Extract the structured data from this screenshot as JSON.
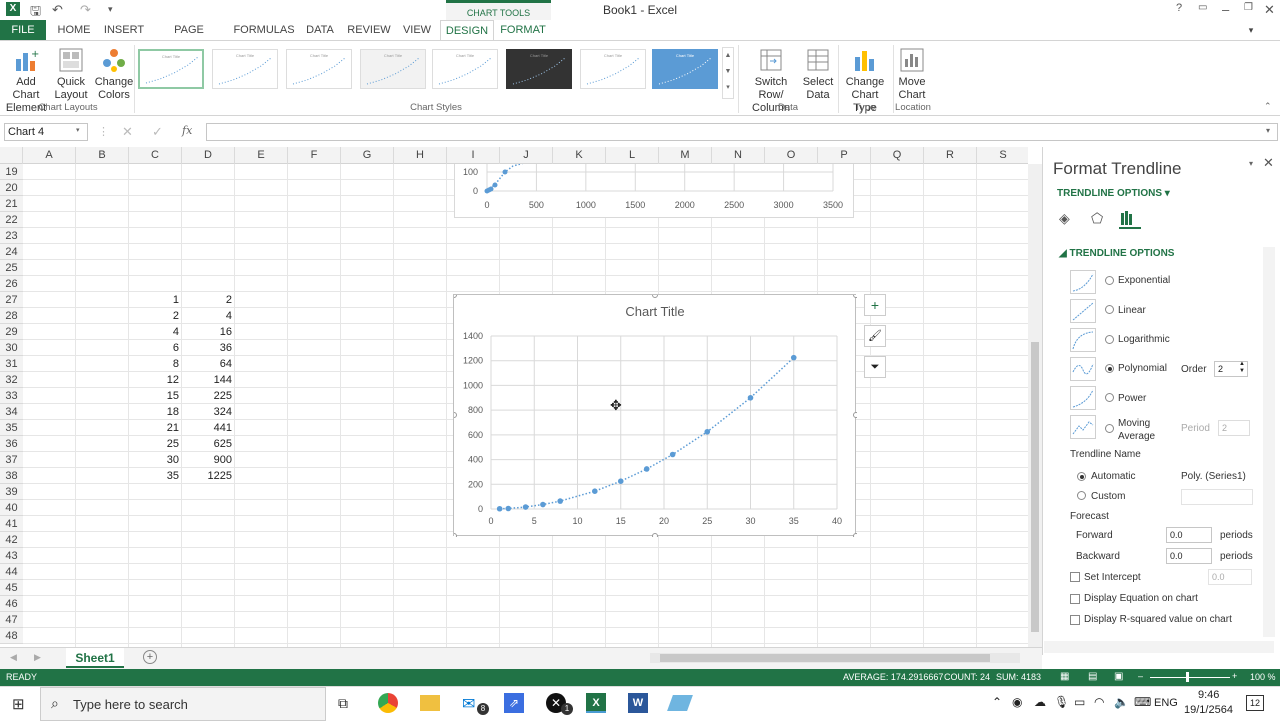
{
  "window": {
    "title": "Book1 - Excel",
    "chart_tools": "CHART TOOLS"
  },
  "tabs": [
    "FILE",
    "HOME",
    "INSERT",
    "PAGE LAYOUT",
    "FORMULAS",
    "DATA",
    "REVIEW",
    "VIEW",
    "DESIGN",
    "FORMAT"
  ],
  "ribbon": {
    "add_chart_element": "Add Chart Element",
    "quick_layout": "Quick Layout",
    "change_colors": "Change Colors",
    "switch_row_column": "Switch Row/ Column",
    "select_data": "Select Data",
    "change_chart_type": "Change Chart Type",
    "move_chart": "Move Chart",
    "groups": {
      "chart_layouts": "Chart Layouts",
      "chart_styles": "Chart Styles",
      "data": "Data",
      "type": "Type",
      "location": "Location"
    }
  },
  "formula_bar": {
    "name_box": "Chart 4",
    "fx": "fx",
    "value": ""
  },
  "columns": [
    "A",
    "B",
    "C",
    "D",
    "E",
    "F",
    "G",
    "H",
    "I",
    "J",
    "K",
    "L",
    "M",
    "N",
    "O",
    "P",
    "Q",
    "R",
    "S"
  ],
  "rows": [
    "19",
    "20",
    "21",
    "22",
    "23",
    "24",
    "25",
    "26",
    "27",
    "28",
    "29",
    "30",
    "31",
    "32",
    "33",
    "34",
    "35",
    "36",
    "37",
    "38",
    "39",
    "40",
    "41",
    "42",
    "43",
    "44",
    "45",
    "46",
    "47",
    "48"
  ],
  "table": {
    "c": [
      "1",
      "2",
      "4",
      "6",
      "8",
      "12",
      "15",
      "18",
      "21",
      "25",
      "30",
      "35"
    ],
    "d": [
      "2",
      "4",
      "16",
      "36",
      "64",
      "144",
      "225",
      "324",
      "441",
      "625",
      "900",
      "1225"
    ]
  },
  "top_chart": {
    "y_ticks": [
      "100",
      "0"
    ],
    "x_ticks": [
      "0",
      "500",
      "1000",
      "1500",
      "2000",
      "2500",
      "3000",
      "3500"
    ]
  },
  "chart_data": {
    "type": "scatter",
    "title": "Chart Title",
    "x": [
      1,
      2,
      4,
      6,
      8,
      12,
      15,
      18,
      21,
      25,
      30,
      35
    ],
    "y": [
      2,
      4,
      16,
      36,
      64,
      144,
      225,
      324,
      441,
      625,
      900,
      1225
    ],
    "xlim": [
      0,
      40
    ],
    "ylim": [
      0,
      1400
    ],
    "x_ticks": [
      "0",
      "5",
      "10",
      "15",
      "20",
      "25",
      "30",
      "35",
      "40"
    ],
    "y_ticks": [
      "0",
      "200",
      "400",
      "600",
      "800",
      "1000",
      "1200",
      "1400"
    ],
    "trendline": "polynomial",
    "grid": true,
    "color": "#5b9bd5"
  },
  "sheet": {
    "tab": "Sheet1"
  },
  "status": {
    "ready": "READY",
    "average": "AVERAGE: 174.2916667",
    "count": "COUNT: 24",
    "sum": "SUM: 4183",
    "zoom": "100 %"
  },
  "pane": {
    "title": "Format Trendline",
    "options_header": "TRENDLINE OPTIONS",
    "section": "TRENDLINE OPTIONS",
    "types": [
      "Exponential",
      "Linear",
      "Logarithmic",
      "Polynomial",
      "Power",
      "Moving Average"
    ],
    "order_label": "Order",
    "order_value": "2",
    "period_label": "Period",
    "period_value": "2",
    "name_label": "Trendline Name",
    "automatic": "Automatic",
    "automatic_value": "Poly. (Series1)",
    "custom": "Custom",
    "forecast": "Forecast",
    "forward": "Forward",
    "forward_value": "0.0",
    "backward": "Backward",
    "backward_value": "0.0",
    "periods": "periods",
    "set_intercept": "Set Intercept",
    "intercept_value": "0.0",
    "display_equation": "Display Equation on chart",
    "display_r2": "Display R-squared value on chart"
  },
  "taskbar": {
    "search_placeholder": "Type here to search",
    "lang": "ENG",
    "time": "9:46",
    "date": "19/1/2564",
    "mail_badge": "8",
    "xbox_badge": "1",
    "notif_badge": "12"
  }
}
